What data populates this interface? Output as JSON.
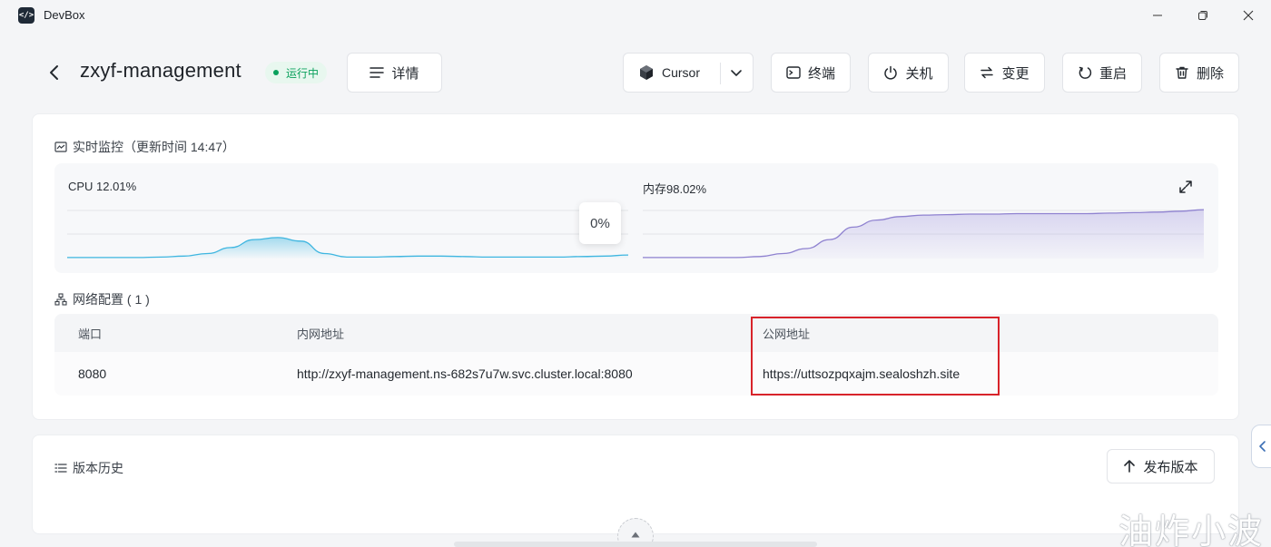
{
  "window": {
    "title": "DevBox"
  },
  "header": {
    "project_name": "zxyf-management",
    "status": "运行中",
    "detail_label": "详情",
    "ide_label": "Cursor",
    "terminal_label": "终端",
    "shutdown_label": "关机",
    "change_label": "变更",
    "restart_label": "重启",
    "delete_label": "删除"
  },
  "monitor": {
    "title": "实时监控（更新时间  14:47）",
    "cpu_label": "CPU 12.01%",
    "memory_label": "内存98.02%",
    "tooltip": "0%",
    "cpu_series": [
      0.02,
      0.02,
      0.02,
      0.02,
      0.03,
      0.05,
      0.1,
      0.22,
      0.38,
      0.42,
      0.35,
      0.1,
      0.03,
      0.03,
      0.04,
      0.05,
      0.05,
      0.04,
      0.03,
      0.03,
      0.03,
      0.03,
      0.04,
      0.05,
      0.07
    ],
    "memory_series": [
      0.02,
      0.02,
      0.02,
      0.02,
      0.02,
      0.04,
      0.1,
      0.2,
      0.38,
      0.63,
      0.77,
      0.84,
      0.87,
      0.88,
      0.89,
      0.89,
      0.9,
      0.9,
      0.9,
      0.9,
      0.91,
      0.92,
      0.93,
      0.95,
      0.98
    ],
    "colors": {
      "cpu": "#3fb6e0",
      "memory": "#8f82d0"
    }
  },
  "network": {
    "title": "网络配置 ( 1 )",
    "columns": [
      "端口",
      "内网地址",
      "公网地址"
    ],
    "rows": [
      {
        "port": "8080",
        "internal": "http://zxyf-management.ns-682s7u7w.svc.cluster.local:8080",
        "public": "https://uttsozpqxajm.sealoshzh.site"
      }
    ]
  },
  "history": {
    "title": "版本历史",
    "publish_label": "发布版本"
  },
  "watermark": "油炸小波"
}
